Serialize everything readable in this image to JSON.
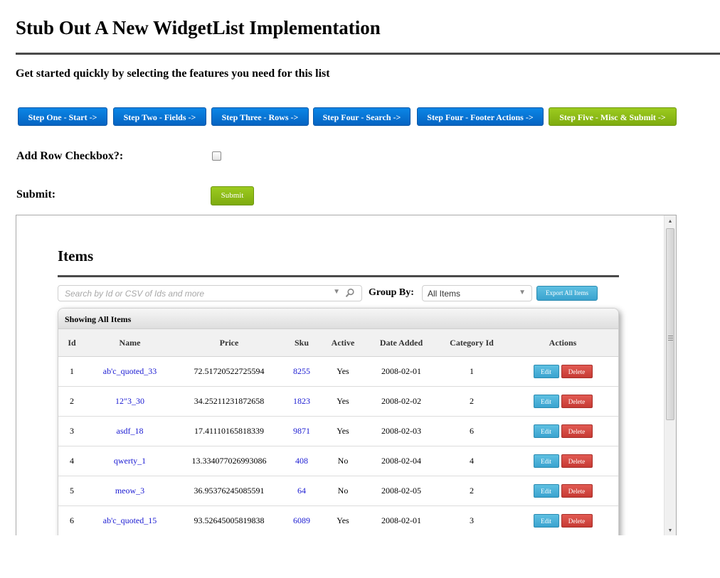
{
  "page": {
    "title": "Stub Out A New WidgetList Implementation",
    "subtitle": "Get started quickly by selecting the features you need for this list"
  },
  "steps": [
    {
      "label": "Step One - Start ->",
      "active": false
    },
    {
      "label": "Step Two - Fields ->",
      "active": false
    },
    {
      "label": "Step Three - Rows ->",
      "active": false
    },
    {
      "label": "Step Four - Search ->",
      "active": false
    },
    {
      "label": "Step Four - Footer Actions ->",
      "active": false
    },
    {
      "label": "Step Five - Misc & Submit ->",
      "active": true
    }
  ],
  "form": {
    "add_row_checkbox_label": "Add Row Checkbox?:",
    "add_row_checkbox_checked": false,
    "submit_label": "Submit:",
    "submit_button": "Submit"
  },
  "preview": {
    "title": "Items",
    "search_placeholder": "Search by Id or CSV of Ids and more",
    "group_by_label": "Group By:",
    "group_by_value": "All Items",
    "export_button": "Export All Items",
    "panel_header": "Showing All Items",
    "columns": [
      "Id",
      "Name",
      "Price",
      "Sku",
      "Active",
      "Date Added",
      "Category Id",
      "Actions"
    ],
    "rows": [
      {
        "id": "1",
        "name": "ab'c_quoted_33",
        "price": "72.51720522725594",
        "sku": "8255",
        "active": "Yes",
        "date": "2008-02-01",
        "category": "1"
      },
      {
        "id": "2",
        "name": "12\"3_30",
        "price": "34.25211231872658",
        "sku": "1823",
        "active": "Yes",
        "date": "2008-02-02",
        "category": "2"
      },
      {
        "id": "3",
        "name": "asdf_18",
        "price": "17.41110165818339",
        "sku": "9871",
        "active": "Yes",
        "date": "2008-02-03",
        "category": "6"
      },
      {
        "id": "4",
        "name": "qwerty_1",
        "price": "13.334077026993086",
        "sku": "408",
        "active": "No",
        "date": "2008-02-04",
        "category": "4"
      },
      {
        "id": "5",
        "name": "meow_3",
        "price": "36.95376245085591",
        "sku": "64",
        "active": "No",
        "date": "2008-02-05",
        "category": "2"
      },
      {
        "id": "6",
        "name": "ab'c_quoted_15",
        "price": "93.52645005819838",
        "sku": "6089",
        "active": "Yes",
        "date": "2008-02-01",
        "category": "3"
      },
      {
        "id": "",
        "name": "",
        "price": "",
        "sku": "",
        "active": "",
        "date": "",
        "category": ""
      }
    ],
    "edit_label": "Edit",
    "delete_label": "Delete"
  },
  "colors": {
    "step_blue": "#0564c2",
    "step_active_green": "#7eab0f",
    "edit_blue": "#3aa3cf",
    "delete_red": "#c63a33",
    "link_blue": "#1a1ad2"
  }
}
